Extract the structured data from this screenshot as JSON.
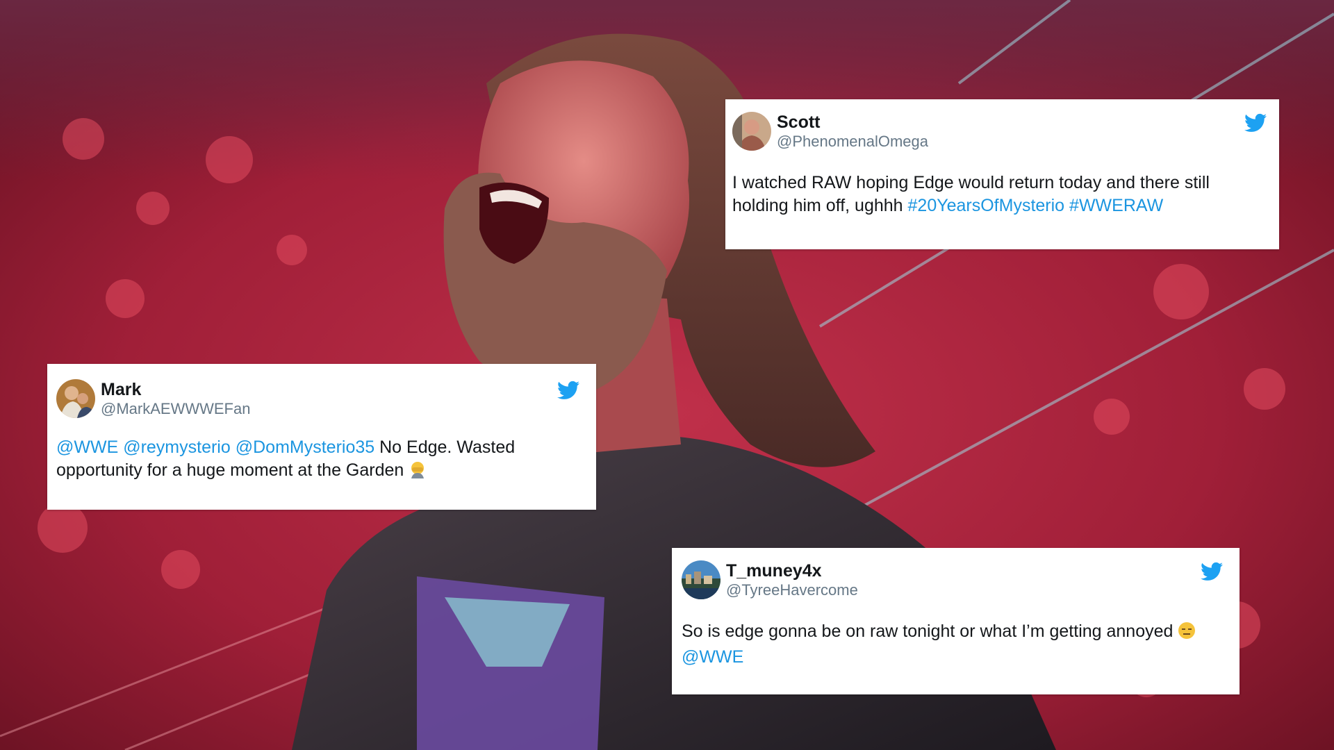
{
  "colors": {
    "link": "#1b95e0",
    "twitter_blue": "#1da1f2",
    "name_text": "#14171a",
    "handle_text": "#657786"
  },
  "tweets": [
    {
      "display_name": "Scott",
      "handle": "@PhenomenalOmega",
      "text_plain_1": "I watched RAW hoping Edge would return today and there still holding him off, ughhh ",
      "hashtag_1": "#20YearsOfMysterio",
      "hashtag_2": "#WWERAW",
      "icon": "twitter-bird-icon"
    },
    {
      "display_name": "Mark",
      "handle": "@MarkAEWWWEFan",
      "mention_1": "@WWE",
      "mention_2": "@reymysterio",
      "mention_3": "@DomMysterio35",
      "text_plain_1": " No Edge. Wasted opportunity for a huge moment at the Garden ",
      "emoji": "facepalm-emoji",
      "icon": "twitter-bird-icon"
    },
    {
      "display_name": "T_muney4x",
      "handle": "@TyreeHavercome",
      "text_plain_1": "So is edge gonna be on raw tonight or what I’m getting annoyed ",
      "emoji": "expressionless-face-emoji",
      "mention_1": "@WWE",
      "icon": "twitter-bird-icon"
    }
  ]
}
